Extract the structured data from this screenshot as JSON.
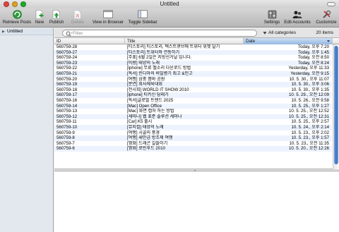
{
  "window": {
    "title": "Untitled"
  },
  "toolbar": {
    "retrieve_posts": "Retrieve Posts",
    "new": "New",
    "publish": "Publish",
    "delete": "Delete",
    "view_in_browser": "View in Browser",
    "toggle_sidebar": "Toggle Sidebar",
    "settings": "Settings",
    "edit_accounts": "Edit Accounts",
    "customize": "Customize"
  },
  "sidebar": {
    "items": [
      {
        "label": "Untitled"
      }
    ]
  },
  "search": {
    "placeholder": "Filter",
    "value": ""
  },
  "category": {
    "selected": "All categories"
  },
  "count": {
    "text": "20 items"
  },
  "table": {
    "columns": {
      "id": "ID",
      "title": "Title",
      "date": "Date"
    },
    "sort": {
      "column": "Date",
      "direction": "descending"
    },
    "rows": [
      {
        "id": "560759-28",
        "title": "[티스토리] 티스토리, 텍스트큐브에 트위터 위젯 달기",
        "date": "Today, 오후 7:20"
      },
      {
        "id": "560759-27",
        "title": "[티스토리] 트위터와 연동하기",
        "date": "Today, 오후 1:45"
      },
      {
        "id": "560759-24",
        "title": "[주표] 6월 2일은 지방선거날 입니다.",
        "date": "Today, 오전 8:50"
      },
      {
        "id": "560759-23",
        "title": "[이왕] 태양의 노래",
        "date": "Today, 오전 8:24"
      },
      {
        "id": "560759-22",
        "title": "[iphone] 무료 벨소리 다운로드 방법",
        "date": "Yesterday, 오후 11:33"
      },
      {
        "id": "560759-21",
        "title": "[독서] 린디아의 비밀병기 최고 &인고",
        "date": "Yesterday, 오전 9:15"
      },
      {
        "id": "560759-20",
        "title": "[여행] 삼중 쫌바 공원",
        "date": "10. 5. 30., 오후 11:07"
      },
      {
        "id": "560759-19",
        "title": "[문연] 회사체육대회",
        "date": "10. 5. 30., 오후 3:06"
      },
      {
        "id": "560759-18",
        "title": "[전시회]  WORLD IT SHOW 2010",
        "date": "10. 5. 30., 오후 1:35"
      },
      {
        "id": "560759-17",
        "title": "[iphone] 티키신 담래기",
        "date": "10. 5. 29., 오전 12:09"
      },
      {
        "id": "560759-16",
        "title": "[독서]글로벌 트렌드 2025",
        "date": "10. 5. 26., 오전 9:58"
      },
      {
        "id": "560759-14",
        "title": "[Mac] Open Office",
        "date": "10. 5. 25., 오후 1:27"
      },
      {
        "id": "560759-13",
        "title": "[Mac] 화면 캡처 하는 방법",
        "date": "10. 5. 25., 오전 12:52"
      },
      {
        "id": "560759-12",
        "title": "[세미나] 웹 표준 솔루션 세미나",
        "date": "10. 5. 25., 오전 12:31"
      },
      {
        "id": "560759-11",
        "title": "[Car] K5 출시",
        "date": "10. 5. 25., 오후 2:57"
      },
      {
        "id": "560759-10",
        "title": "[뮤지컬] 태양의 노래",
        "date": "10. 5. 24., 오후 2:14"
      },
      {
        "id": "560759-9",
        "title": "[여행] 시골의 풍경",
        "date": "10. 5. 23., 오후 2:02"
      },
      {
        "id": "560759-8",
        "title": "[여행] 새만금 방조제 여행",
        "date": "10. 5. 23., 오후 1:57"
      },
      {
        "id": "560759-7",
        "title": "[영화] 드래곤 길들이기",
        "date": "10. 5. 23., 오전 11:35"
      },
      {
        "id": "560759-6",
        "title": "[영화] 로빈후드 2010",
        "date": "10. 5. 20., 오전 12:26"
      }
    ]
  },
  "colors": {
    "accent": "#3c72c2",
    "row_stripe": "#edf3fe",
    "sidebar_bg": "#e3e8ef"
  }
}
